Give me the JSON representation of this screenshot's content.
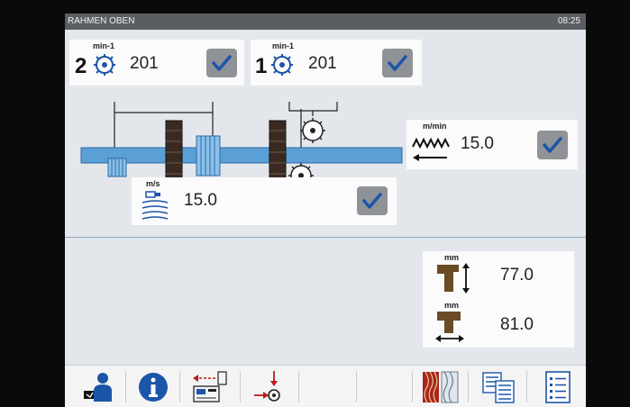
{
  "window": {
    "title": "RAHMEN OBEN",
    "clock": "08:25"
  },
  "spindle_2": {
    "number": "2",
    "unit": "min-1",
    "value": "201",
    "icon": "saw-blade-icon",
    "checked": true
  },
  "spindle_1": {
    "number": "1",
    "unit": "min-1",
    "value": "201",
    "icon": "saw-blade-icon",
    "checked": true
  },
  "feed": {
    "unit": "m/min",
    "value": "15.0",
    "icon": "feed-wave-icon",
    "checked": true
  },
  "cutting_speed": {
    "unit": "m/s",
    "value": "15.0",
    "icon": "cutting-speed-icon",
    "checked": true
  },
  "dimensions": [
    {
      "unit": "mm",
      "value": "77.0",
      "icon": "profile-height-icon"
    },
    {
      "unit": "mm",
      "value": "81.0",
      "icon": "profile-width-icon"
    }
  ],
  "toolbar": [
    {
      "name": "operator-button",
      "icon": "operator-icon"
    },
    {
      "name": "info-button",
      "icon": "info-icon"
    },
    {
      "name": "machine-transfer-button",
      "icon": "machine-transfer-icon"
    },
    {
      "name": "reference-point-button",
      "icon": "reference-point-icon"
    },
    {
      "name": "wood-profile-button",
      "icon": "wood-profile-icon"
    },
    {
      "name": "parameter-table-button",
      "icon": "parameter-table-icon"
    },
    {
      "name": "list-button",
      "icon": "list-icon"
    }
  ],
  "colors": {
    "accent": "#1b55a8",
    "beam": "#5a9fd6",
    "check_bg": "#8f9398",
    "profile": "#6b4a26"
  }
}
